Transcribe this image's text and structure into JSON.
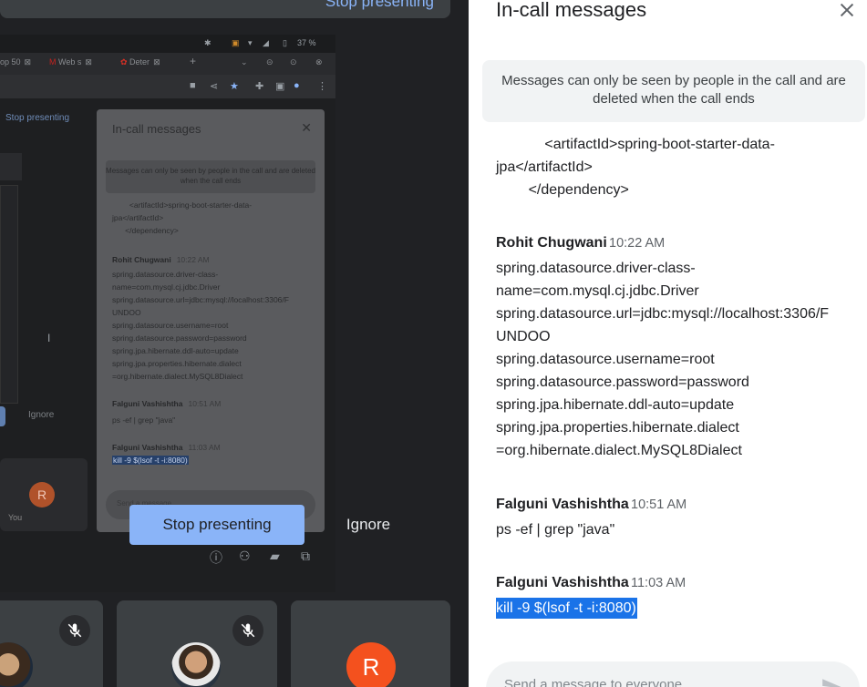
{
  "top_banner": {
    "label": "Stop presenting"
  },
  "share": {
    "status": {
      "battery": "37 %"
    },
    "tabs": [
      {
        "label": "op 50"
      },
      {
        "label": "Web s"
      },
      {
        "label": "Deter"
      }
    ],
    "new_tab": "+",
    "stop_presenting": "Stop presenting",
    "ignore": "Ignore",
    "you_avatar": "R",
    "you_label": "You",
    "panel": {
      "title": "In-call messages",
      "notice": "Messages can only be seen by people in the call and are deleted when the call ends",
      "lines_top": "        <artifactId>spring-boot-starter-data-\njpa</artifactId>\n      </dependency>",
      "sender1": "Rohit Chugwani",
      "time1": "10:22 AM",
      "lines1": "spring.datasource.driver-class-\nname=com.mysql.cj.jdbc.Driver\nspring.datasource.url=jdbc:mysql://localhost:3306/F\nUNDOO\nspring.datasource.username=root\nspring.datasource.password=password\nspring.jpa.hibernate.ddl-auto=update\nspring.jpa.properties.hibernate.dialect\n=org.hibernate.dialect.MySQL8Dialect",
      "sender2": "Falguni Vashishtha",
      "time2": "10:51 AM",
      "line2": "ps -ef | grep \"java\"",
      "sender3": "Falguni Vashishtha",
      "time3": "11:03 AM",
      "line3": "kill -9 $(lsof -t -i:8080)",
      "compose_placeholder": "Send a message"
    }
  },
  "actions": {
    "stop_presenting": "Stop presenting",
    "ignore": "Ignore"
  },
  "tiles": [
    {
      "avatar": ""
    },
    {
      "avatar": ""
    },
    {
      "avatar": "R"
    }
  ],
  "panel": {
    "title": "In-call messages",
    "notice": "Messages can only be seen by people in the call and are deleted when the call ends",
    "messages_top": [
      "            <artifactId>spring-boot-starter-data-",
      "jpa</artifactId>",
      "        </dependency>"
    ],
    "messages": [
      {
        "sender": "Rohit Chugwani",
        "time": "10:22 AM",
        "lines": [
          "spring.datasource.driver-class-",
          "name=com.mysql.cj.jdbc.Driver",
          "spring.datasource.url=jdbc:mysql://localhost:3306/F",
          "UNDOO",
          "spring.datasource.username=root",
          "spring.datasource.password=password",
          "spring.jpa.hibernate.ddl-auto=update",
          "spring.jpa.properties.hibernate.dialect",
          "=org.hibernate.dialect.MySQL8Dialect"
        ]
      },
      {
        "sender": "Falguni Vashishtha",
        "time": "10:51 AM",
        "lines": [
          "ps -ef | grep \"java\""
        ]
      },
      {
        "sender": "Falguni Vashishtha",
        "time": "11:03 AM",
        "lines": [
          "kill -9 $(lsof -t -i:8080)"
        ]
      }
    ],
    "compose_placeholder": "Send a message to everyone"
  },
  "colors": {
    "accent": "#8ab4f8",
    "selection": "#1a73e8",
    "avatar_orange": "#f4511e",
    "stage_bg": "#202124"
  },
  "icons": {
    "close": "close-icon",
    "send": "send-icon",
    "mic_off": "mic-off-icon",
    "info": "info-icon",
    "people": "people-icon",
    "chat": "chat-icon",
    "activities": "activities-icon"
  }
}
